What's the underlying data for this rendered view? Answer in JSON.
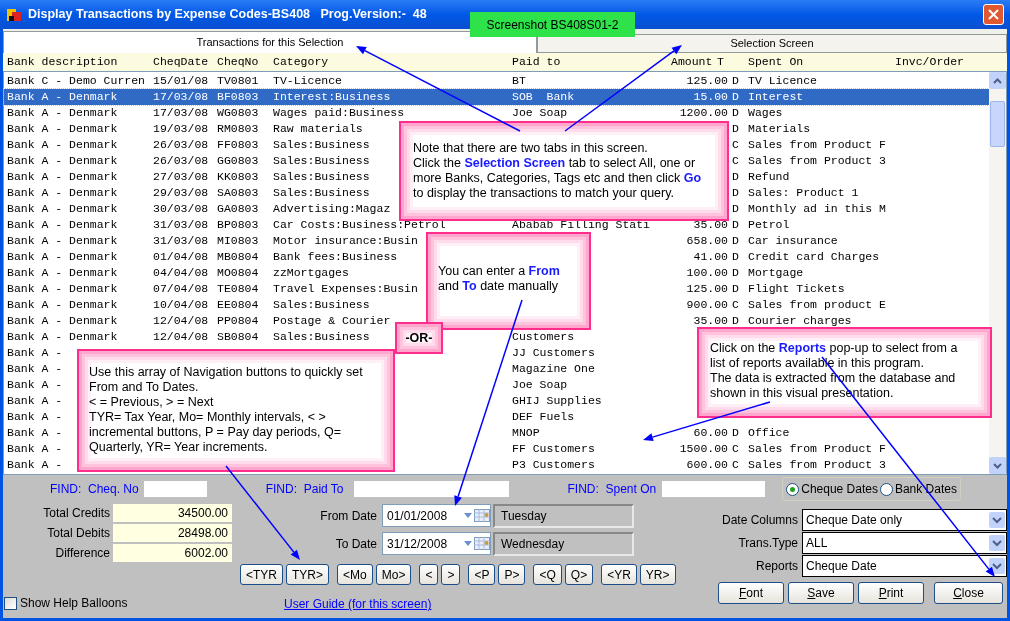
{
  "window": {
    "title": "Display Transactions by Expense Codes-BS408   Prog.Version:-  48"
  },
  "screenshot_label": "Screenshot BS408S01-2",
  "tabs": [
    {
      "label": "Transactions for this Selection",
      "selected": true
    },
    {
      "label": "Selection Screen",
      "selected": false
    }
  ],
  "table": {
    "columns": [
      "Bank description",
      "CheqDate",
      "CheqNo",
      "Category",
      "Paid to",
      "Amount",
      "T",
      "Spent On",
      "Invc/Order"
    ],
    "rows": [
      {
        "bank": "Bank C - Demo Curren",
        "date": "15/01/08",
        "cheq_no": "TV0801",
        "category": "TV-Licence",
        "paid_to": "BT",
        "amount": "125.00",
        "t": "D",
        "spent_on": "TV Licence",
        "selected": false
      },
      {
        "bank": "Bank A - Denmark",
        "date": "17/03/08",
        "cheq_no": "BF0803",
        "category": "Interest:Business",
        "paid_to": "SOB  Bank",
        "amount": "15.00",
        "t": "D",
        "spent_on": "Interest",
        "selected": true
      },
      {
        "bank": "Bank A - Denmark",
        "date": "17/03/08",
        "cheq_no": "WG0803",
        "category": "Wages paid:Business",
        "paid_to": "Joe Soap",
        "amount": "1200.00",
        "t": "D",
        "spent_on": "Wages",
        "selected": false
      },
      {
        "bank": "Bank A - Denmark",
        "date": "19/03/08",
        "cheq_no": "RM0803",
        "category": "Raw materials",
        "t": "D",
        "spent_on": "Materials",
        "selected": false
      },
      {
        "bank": "Bank A - Denmark",
        "date": "26/03/08",
        "cheq_no": "FF0803",
        "category": "Sales:Business",
        "t": "C",
        "spent_on": "Sales from Product F",
        "selected": false
      },
      {
        "bank": "Bank A - Denmark",
        "date": "26/03/08",
        "cheq_no": "GG0803",
        "category": "Sales:Business",
        "t": "C",
        "spent_on": "Sales from Product 3",
        "selected": false
      },
      {
        "bank": "Bank A - Denmark",
        "date": "27/03/08",
        "cheq_no": "KK0803",
        "category": "Sales:Business",
        "t": "D",
        "spent_on": "Refund",
        "selected": false
      },
      {
        "bank": "Bank A - Denmark",
        "date": "29/03/08",
        "cheq_no": "SA0803",
        "category": "Sales:Business",
        "t": "D",
        "spent_on": "Sales: Product 1",
        "selected": false
      },
      {
        "bank": "Bank A - Denmark",
        "date": "30/03/08",
        "cheq_no": "GA0803",
        "category": "Advertising:Magaz",
        "t": "D",
        "spent_on": "Monthly ad in this M",
        "selected": false
      },
      {
        "bank": "Bank A - Denmark",
        "date": "31/03/08",
        "cheq_no": "BP0803",
        "category": "Car Costs:Business:Petrol",
        "paid_to": "Ababab Filling Stati",
        "amount": "35.00",
        "t": "D",
        "spent_on": "Petrol",
        "selected": false
      },
      {
        "bank": "Bank A - Denmark",
        "date": "31/03/08",
        "cheq_no": "MI0803",
        "category": "Motor insurance:Busin",
        "amount": "658.00",
        "t": "D",
        "spent_on": "Car insurance",
        "selected": false
      },
      {
        "bank": "Bank A - Denmark",
        "date": "01/04/08",
        "cheq_no": "MB0804",
        "category": "Bank fees:Business",
        "amount": "41.00",
        "t": "D",
        "spent_on": "Credit card Charges",
        "selected": false
      },
      {
        "bank": "Bank A - Denmark",
        "date": "04/04/08",
        "cheq_no": "MO0804",
        "category": "zzMortgages",
        "amount": "100.00",
        "t": "D",
        "spent_on": "Mortgage",
        "selected": false
      },
      {
        "bank": "Bank A - Denmark",
        "date": "07/04/08",
        "cheq_no": "TE0804",
        "category": "Travel Expenses:Busin",
        "amount": "125.00",
        "t": "D",
        "spent_on": "Flight Tickets",
        "selected": false
      },
      {
        "bank": "Bank A - Denmark",
        "date": "10/04/08",
        "cheq_no": "EE0804",
        "category": "Sales:Business",
        "amount": "900.00",
        "t": "C",
        "spent_on": "Sales from product E",
        "selected": false
      },
      {
        "bank": "Bank A - Denmark",
        "date": "12/04/08",
        "cheq_no": "PP0804",
        "category": "Postage & Courier",
        "amount": "35.00",
        "t": "D",
        "spent_on": "Courier charges",
        "selected": false
      },
      {
        "bank": "Bank A - Denmark",
        "date": "12/04/08",
        "cheq_no": "SB0804",
        "category": "Sales:Business",
        "paid_to": "Customers",
        "selected": false
      },
      {
        "bank": "Bank A -",
        "paid_to": "JJ Customers",
        "selected": false
      },
      {
        "bank": "Bank A -",
        "paid_to": "Magazine One",
        "selected": false
      },
      {
        "bank": "Bank A -",
        "paid_to": "Joe Soap",
        "selected": false
      },
      {
        "bank": "Bank A -",
        "paid_to": "GHIJ Supplies",
        "selected": false
      },
      {
        "bank": "Bank A -",
        "paid_to": "DEF Fuels",
        "selected": false
      },
      {
        "bank": "Bank A -",
        "paid_to": "MNOP",
        "amount": "60.00",
        "t": "D",
        "spent_on": "Office",
        "selected": false
      },
      {
        "bank": "Bank A -",
        "paid_to": "FF Customers",
        "amount": "1500.00",
        "t": "C",
        "spent_on": "Sales from Product F",
        "selected": false
      },
      {
        "bank": "Bank A -",
        "paid_to": "P3 Customers",
        "amount": "600.00",
        "t": "C",
        "spent_on": "Sales from Product 3",
        "selected": false
      }
    ]
  },
  "callouts": [
    {
      "text": "Note that there are two tabs in this screen.\nClick the **Selection Screen** tab to select All, one or\nmore Banks, Categories, Tags etc and then click **Go**\nto display the transactions to match your query."
    },
    {
      "text": "You can enter a **From**\nand **To** date manually"
    },
    {
      "text": "-OR-"
    },
    {
      "text": "Use this array of Navigation buttons to quickly set\nFrom and To Dates.\n< = Previous, > = Next\nTYR= Tax Year, Mo= Monthly intervals, < >\nincremental buttons, P = Pay day periods, Q=\nQuarterly, YR= Year increments."
    },
    {
      "text": "Click on the **Reports** pop-up to select from a\nlist of reports available in this program.\nThe data is extracted from the database and\nshown in this visual presentation."
    }
  ],
  "find": [
    {
      "label": "FIND:  Cheq. No"
    },
    {
      "label": "FIND:  Paid To"
    },
    {
      "label": "FIND:  Spent On"
    }
  ],
  "date_mode": [
    {
      "label": "Cheque Dates",
      "selected": true
    },
    {
      "label": "Bank Dates",
      "selected": false
    }
  ],
  "totals": [
    {
      "label": "Total Credits",
      "value": "34500.00"
    },
    {
      "label": "Total Debits",
      "value": "28498.00"
    },
    {
      "label": "Difference",
      "value": "6002.00"
    }
  ],
  "dates": [
    {
      "label": "From Date",
      "value": "01/01/2008",
      "day": "Tuesday"
    },
    {
      "label": "To Date",
      "value": "31/12/2008",
      "day": "Wednesday"
    }
  ],
  "nav_buttons": [
    "<TYR",
    "TYR>",
    "<Mo",
    "Mo>",
    "<",
    ">",
    "<P",
    "P>",
    "<Q",
    "Q>",
    "<YR",
    "YR>"
  ],
  "help_balloons": {
    "label": "Show Help Balloons",
    "checked": false
  },
  "user_guide_link": "User Guide (for this screen)",
  "dropdowns": [
    {
      "label": "Date Columns",
      "value": "Cheque Date only"
    },
    {
      "label": "Trans.Type",
      "value": "ALL"
    },
    {
      "label": "Reports",
      "value": "Cheque Date"
    }
  ],
  "buttons": [
    "Font",
    "Save",
    "Print",
    "Close"
  ]
}
